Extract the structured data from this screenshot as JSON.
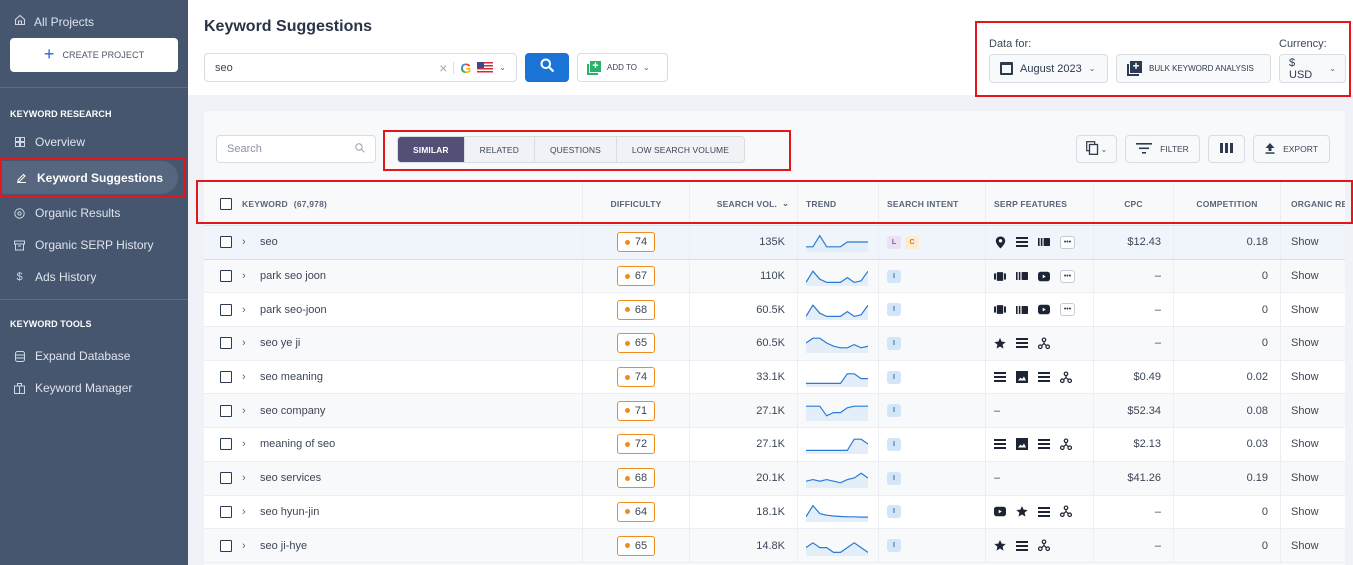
{
  "sidebar": {
    "all_projects": "All Projects",
    "create_project": "CREATE PROJECT",
    "sections": [
      {
        "title": "KEYWORD RESEARCH",
        "items": [
          {
            "label": "Overview",
            "icon": "grid-icon"
          },
          {
            "label": "Keyword Suggestions",
            "icon": "pencil-icon",
            "active": true
          },
          {
            "label": "Organic Results",
            "icon": "target-icon"
          },
          {
            "label": "Organic SERP History",
            "icon": "archive-icon"
          },
          {
            "label": "Ads History",
            "icon": "dollar-icon"
          }
        ]
      },
      {
        "title": "KEYWORD TOOLS",
        "items": [
          {
            "label": "Expand Database",
            "icon": "database-icon"
          },
          {
            "label": "Keyword Manager",
            "icon": "briefcase-icon"
          }
        ]
      }
    ]
  },
  "header": {
    "title": "Keyword Suggestions",
    "search_value": "seo",
    "search_engine": "Google",
    "country": "US",
    "add_to": "ADD TO",
    "data_for_label": "Data for:",
    "date_value": "August 2023",
    "bulk_label": "BULK KEYWORD ANALYSIS",
    "currency_label": "Currency:",
    "currency_value": "$ USD"
  },
  "toolbar": {
    "search_placeholder": "Search",
    "tabs": [
      {
        "label": "SIMILAR",
        "active": true
      },
      {
        "label": "RELATED"
      },
      {
        "label": "QUESTIONS"
      },
      {
        "label": "LOW SEARCH VOLUME"
      }
    ],
    "filter": "FILTER",
    "export": "EXPORT"
  },
  "table": {
    "columns": {
      "keyword": "KEYWORD",
      "keyword_count": "(67,978)",
      "difficulty": "DIFFICULTY",
      "search_vol": "SEARCH VOL.",
      "trend": "TREND",
      "search_intent": "SEARCH INTENT",
      "serp_features": "SERP FEATURES",
      "cpc": "CPC",
      "competition": "COMPETITION",
      "organic": "ORGANIC RE"
    },
    "rows": [
      {
        "keyword": "seo",
        "difficulty": "74",
        "volume": "135K",
        "trend": [
          2,
          2,
          9,
          2,
          2,
          2,
          5,
          5,
          5,
          5
        ],
        "intent": [
          "L",
          "C"
        ],
        "serp": [
          "map-pin",
          "list-lines",
          "carousel",
          "more"
        ],
        "cpc": "$12.43",
        "competition": "0.18",
        "organic": "Show"
      },
      {
        "keyword": "park seo joon",
        "difficulty": "67",
        "volume": "110K",
        "trend": [
          1,
          8,
          3,
          1,
          1,
          1,
          4,
          1,
          2,
          8
        ],
        "intent": [
          "I"
        ],
        "serp": [
          "video-carousel",
          "carousel",
          "youtube",
          "more"
        ],
        "cpc": "–",
        "competition": "0",
        "organic": "Show"
      },
      {
        "keyword": "park seo-joon",
        "difficulty": "68",
        "volume": "60.5K",
        "trend": [
          1,
          8,
          3,
          1,
          1,
          1,
          4,
          1,
          2,
          8
        ],
        "intent": [
          "I"
        ],
        "serp": [
          "video-carousel",
          "carousel",
          "youtube",
          "more"
        ],
        "cpc": "–",
        "competition": "0",
        "organic": "Show"
      },
      {
        "keyword": "seo ye ji",
        "difficulty": "65",
        "volume": "60.5K",
        "trend": [
          5,
          8,
          8,
          5,
          3,
          2,
          2,
          4,
          2,
          3
        ],
        "intent": [
          "I"
        ],
        "serp": [
          "star",
          "list-lines",
          "network"
        ],
        "cpc": "–",
        "competition": "0",
        "organic": "Show"
      },
      {
        "keyword": "seo meaning",
        "difficulty": "74",
        "volume": "33.1K",
        "trend": [
          1,
          1,
          1,
          1,
          1,
          1,
          7,
          7,
          4,
          4
        ],
        "intent": [
          "I"
        ],
        "serp": [
          "list-lines",
          "image",
          "list-lines",
          "network"
        ],
        "cpc": "$0.49",
        "competition": "0.02",
        "organic": "Show"
      },
      {
        "keyword": "seo company",
        "difficulty": "71",
        "volume": "27.1K",
        "trend": [
          8,
          8,
          8,
          2,
          4,
          4,
          7,
          8,
          8,
          8
        ],
        "intent": [
          "I"
        ],
        "serp": [],
        "cpc": "$52.34",
        "competition": "0.08",
        "organic": "Show"
      },
      {
        "keyword": "meaning of seo",
        "difficulty": "72",
        "volume": "27.1K",
        "trend": [
          1,
          1,
          1,
          1,
          1,
          1,
          1,
          8,
          8,
          5
        ],
        "intent": [
          "I"
        ],
        "serp": [
          "list-lines",
          "image",
          "list-lines",
          "network"
        ],
        "cpc": "$2.13",
        "competition": "0.03",
        "organic": "Show"
      },
      {
        "keyword": "seo services",
        "difficulty": "68",
        "volume": "20.1K",
        "trend": [
          3,
          4,
          3,
          4,
          3,
          2,
          4,
          5,
          8,
          5
        ],
        "intent": [
          "I"
        ],
        "serp": [],
        "cpc": "$41.26",
        "competition": "0.19",
        "organic": "Show"
      },
      {
        "keyword": "seo hyun-jin",
        "difficulty": "64",
        "volume": "18.1K",
        "trend": [
          2,
          9,
          4,
          3,
          2.5,
          2.2,
          2,
          2,
          1.8,
          1.8
        ],
        "intent": [
          "I"
        ],
        "serp": [
          "youtube",
          "star",
          "list-lines",
          "network"
        ],
        "cpc": "–",
        "competition": "0",
        "organic": "Show"
      },
      {
        "keyword": "seo ji-hye",
        "difficulty": "65",
        "volume": "14.8K",
        "trend": [
          4,
          7,
          4,
          4,
          1,
          1,
          4,
          7,
          4,
          1
        ],
        "intent": [
          "I"
        ],
        "serp": [
          "star",
          "list-lines",
          "network"
        ],
        "cpc": "–",
        "competition": "0",
        "organic": "Show"
      }
    ]
  }
}
